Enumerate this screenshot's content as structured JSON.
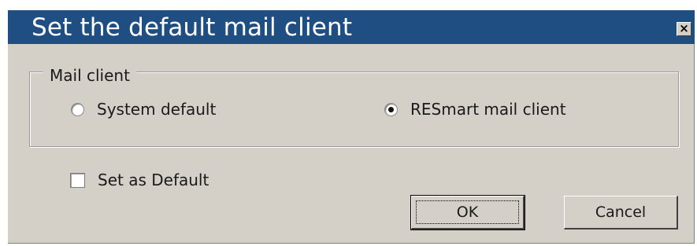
{
  "dialog": {
    "title": "Set the default mail client",
    "close_glyph": "×"
  },
  "mail_client_group": {
    "label": "Mail client",
    "options": [
      {
        "label": "System default",
        "checked": false
      },
      {
        "label": "RESmart mail client",
        "checked": true
      }
    ]
  },
  "set_as_default": {
    "label": "Set as Default",
    "checked": false
  },
  "buttons": {
    "ok_label": "OK",
    "cancel_label": "Cancel"
  },
  "colors": {
    "titlebar": "#1f4e83",
    "dialog_background": "#d4d0c8"
  },
  "icons": {
    "close": "close-icon"
  }
}
